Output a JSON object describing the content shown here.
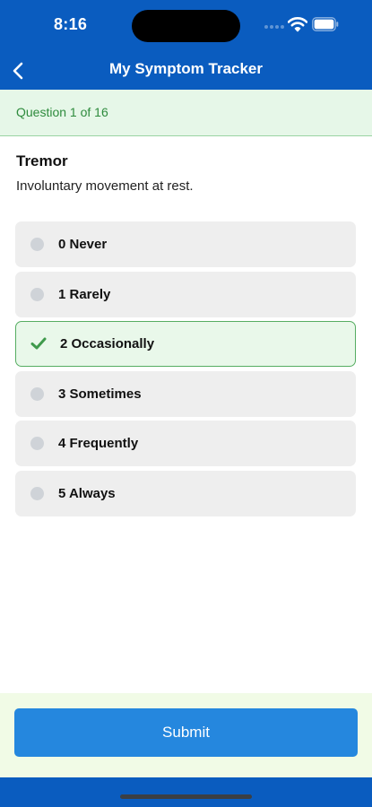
{
  "status_bar": {
    "time": "8:16"
  },
  "nav": {
    "title": "My Symptom Tracker",
    "back_icon": "chevron-left-icon"
  },
  "progress": {
    "text": "Question 1 of 16"
  },
  "question": {
    "title": "Tremor",
    "description": "Involuntary movement at rest.",
    "options": [
      {
        "label": "0 Never",
        "selected": false
      },
      {
        "label": "1 Rarely",
        "selected": false
      },
      {
        "label": "2 Occasionally",
        "selected": true
      },
      {
        "label": "3 Sometimes",
        "selected": false
      },
      {
        "label": "4 Frequently",
        "selected": false
      },
      {
        "label": "5 Always",
        "selected": false
      }
    ]
  },
  "footer": {
    "submit_label": "Submit"
  },
  "colors": {
    "header": "#0a5cbf",
    "progress_bg": "#e6f7e8",
    "progress_text": "#2e8b3d",
    "option_bg": "#eeeeee",
    "selected_bg": "#e9f8ea",
    "selected_border": "#56ad62",
    "submit": "#2587de",
    "footer_bg": "#f1fbe6"
  }
}
